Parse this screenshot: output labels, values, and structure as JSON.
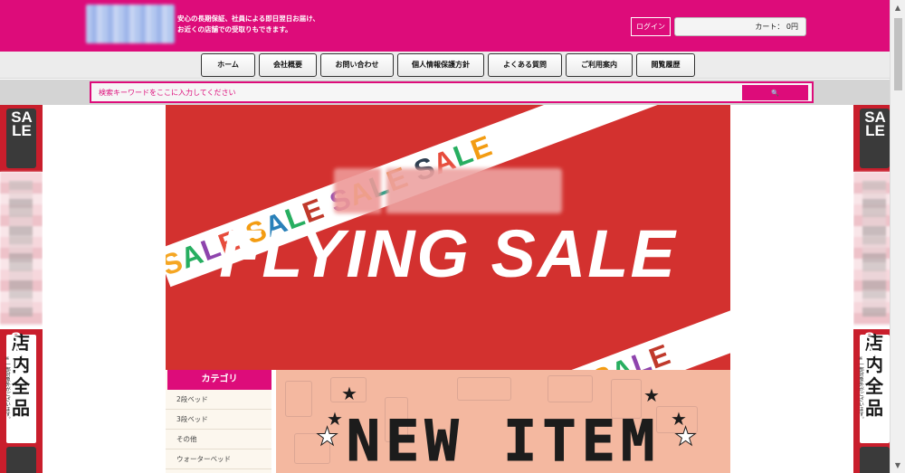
{
  "header": {
    "tagline_line1": "安心の長期保証、社員による即日翌日お届け、",
    "tagline_line2": "お近くの店舗での受取りもできます。",
    "login_label": "ログイン",
    "cart_label": "カート：",
    "cart_amount": "0円"
  },
  "nav": {
    "items": [
      {
        "label": "ホーム"
      },
      {
        "label": "会社概要"
      },
      {
        "label": "お問い合わせ"
      },
      {
        "label": "個人情報保護方針"
      },
      {
        "label": "よくある質問"
      },
      {
        "label": "ご利用案内"
      },
      {
        "label": "閲覧履歴"
      }
    ]
  },
  "search": {
    "placeholder": "検索キーワードをここに入力してください",
    "button_icon": "search-icon",
    "button_glyph": "🔍"
  },
  "side_banners": {
    "sale_text": "SALE",
    "store_text": "店内全品",
    "store_note": "※一部対象外がございます。",
    "store_sale_text": "SAL"
  },
  "hero": {
    "ribbon_text_top": "SALE SALE SALE SALE SALE",
    "ribbon_text_bottom": "SALE SALE SALE SALE",
    "title": "FLYING SALE",
    "colors": {
      "background": "#d3312f",
      "accent": "#dd0c7a"
    }
  },
  "category": {
    "title": "カテゴリ",
    "items": [
      {
        "label": "2段ベッド"
      },
      {
        "label": "3段ベッド"
      },
      {
        "label": "その他"
      },
      {
        "label": "ウォーターベッド"
      }
    ]
  },
  "new_item": {
    "title": "NEW ITEM"
  }
}
